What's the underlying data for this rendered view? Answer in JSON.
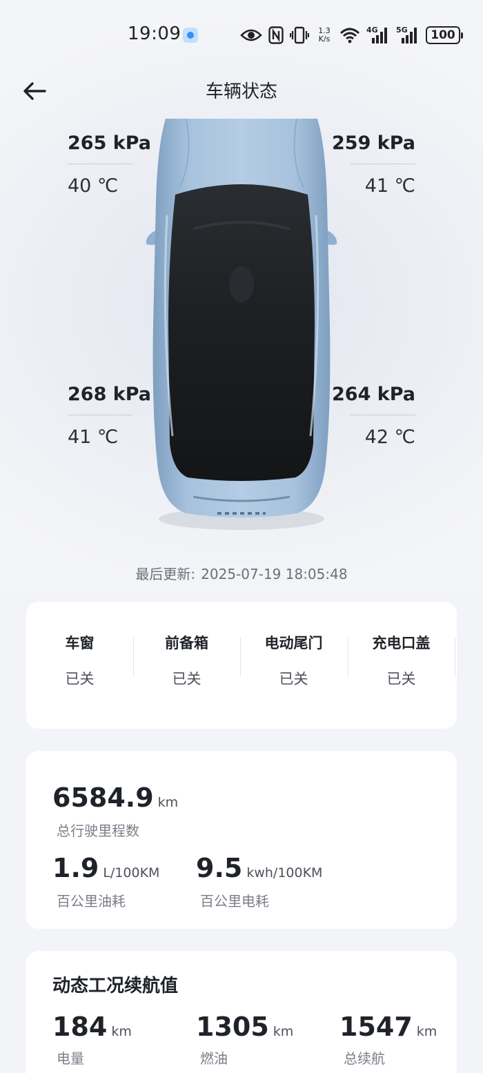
{
  "status_bar": {
    "time": "19:09",
    "speed_value": "1.3",
    "speed_unit": "K/s",
    "net1": "4G",
    "net2": "5G",
    "battery": "100"
  },
  "header": {
    "title": "车辆状态"
  },
  "tires": {
    "front_left": {
      "pressure": "265 kPa",
      "temp": "40 ℃"
    },
    "front_right": {
      "pressure": "259 kPa",
      "temp": "41 ℃"
    },
    "rear_left": {
      "pressure": "268 kPa",
      "temp": "41 ℃"
    },
    "rear_right": {
      "pressure": "264 kPa",
      "temp": "42 ℃"
    }
  },
  "last_update": {
    "label": "最后更新:",
    "time": "2025-07-19 18:05:48"
  },
  "doors": [
    {
      "label": "车窗",
      "status": "已关"
    },
    {
      "label": "前备箱",
      "status": "已关"
    },
    {
      "label": "电动尾门",
      "status": "已关"
    },
    {
      "label": "充电口盖",
      "status": "已关"
    }
  ],
  "stats": {
    "odometer": {
      "value": "6584.9",
      "unit": "km",
      "label": "总行驶里程数"
    },
    "fuel": {
      "value": "1.9",
      "unit": "L/100KM",
      "label": "百公里油耗"
    },
    "power": {
      "value": "9.5",
      "unit": "kwh/100KM",
      "label": "百公里电耗"
    }
  },
  "range": {
    "title": "动态工况续航值",
    "items": [
      {
        "value": "184",
        "unit": "km",
        "label": "电量"
      },
      {
        "value": "1305",
        "unit": "km",
        "label": "燃油"
      },
      {
        "value": "1547",
        "unit": "km",
        "label": "总续航"
      }
    ]
  },
  "colors": {
    "car_body": "#9cb9d6",
    "roof": "#1b1d20",
    "background": "#f3f4f7"
  }
}
